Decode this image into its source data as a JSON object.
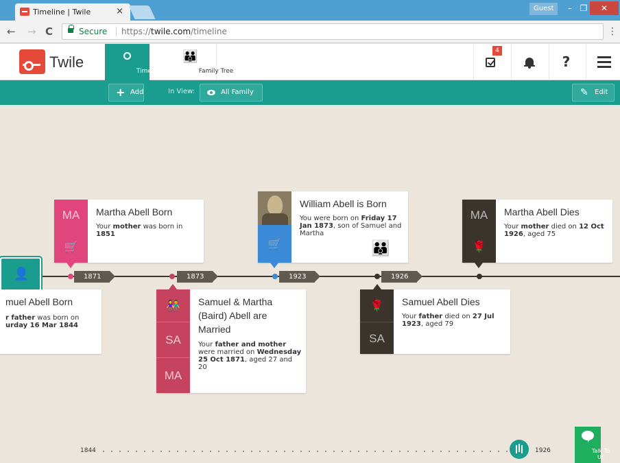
{
  "browser": {
    "tab_title": "Timeline | Twile",
    "tab_close": "×",
    "guest_label": "Guest",
    "min": "–",
    "restore": "❐",
    "close": "✕",
    "back": "←",
    "forward": "→",
    "reload": "C",
    "secure_label": "Secure",
    "url_scheme": "https://",
    "url_host": "twile.com",
    "url_path": "/timeline",
    "menu": "⋮"
  },
  "header": {
    "logo_text": "Twile",
    "nav": [
      {
        "label": "Timeline",
        "active": true
      },
      {
        "label": "Family Tree",
        "active": false
      }
    ],
    "tasks_badge": "4",
    "help": "?"
  },
  "toolbar": {
    "add_label": "Add",
    "in_view_label": "In View:",
    "filter_label": "All Family",
    "edit_label": "Edit"
  },
  "timeline": {
    "years": [
      "1871",
      "1873",
      "1923",
      "1926"
    ],
    "events": [
      {
        "initials": "MA",
        "title": "Martha Abell Born",
        "desc_pre": "Your ",
        "desc_bold1": "mother",
        "desc_mid": " was born in ",
        "desc_bold2": "1851",
        "desc_post": "",
        "color": "#e0457b",
        "icon": "pram-icon"
      },
      {
        "title": "William Abell is Born",
        "desc_pre": "You were born on ",
        "desc_bold1": "Friday 17 Jan 1873",
        "desc_mid": ", son of Samuel and Martha",
        "color": "#3b8ad8",
        "icon": "pram-icon"
      },
      {
        "initials": "MA",
        "title": "Martha Abell Dies",
        "desc_pre": "Your ",
        "desc_bold1": "mother",
        "desc_mid": " died on ",
        "desc_bold2": "12 Oct 1926",
        "desc_post": ", aged 75",
        "color": "#3a342d",
        "icon": "rose-icon"
      },
      {
        "title": "muel Abell Born",
        "line1_bold": "r father",
        "line1_post": " was born on",
        "line2": "urday 16 Mar 1844",
        "color": "#1a9d8f",
        "icon": "person-icon"
      },
      {
        "initials1": "SA",
        "initials2": "MA",
        "title": "Samuel & Martha (Baird) Abell are Married",
        "desc_pre": "Your ",
        "desc_bold1": "father and mother",
        "desc_mid": " were married on ",
        "desc_bold2": "Wednesday 25 Oct 1871",
        "desc_post": ", aged 27 and 20",
        "color": "#c5435f",
        "icon": "couple-icon"
      },
      {
        "initials": "SA",
        "title": "Samuel Abell Dies",
        "desc_pre": "Your ",
        "desc_bold1": "father",
        "desc_mid": " died on ",
        "desc_bold2": "27 Jul 1923",
        "desc_post": ", aged 79",
        "color": "#3a342d",
        "icon": "rose-icon"
      }
    ]
  },
  "scrubber": {
    "start_year": "1844",
    "end_year": "1926"
  },
  "talk": {
    "label": "Talk To Us"
  }
}
